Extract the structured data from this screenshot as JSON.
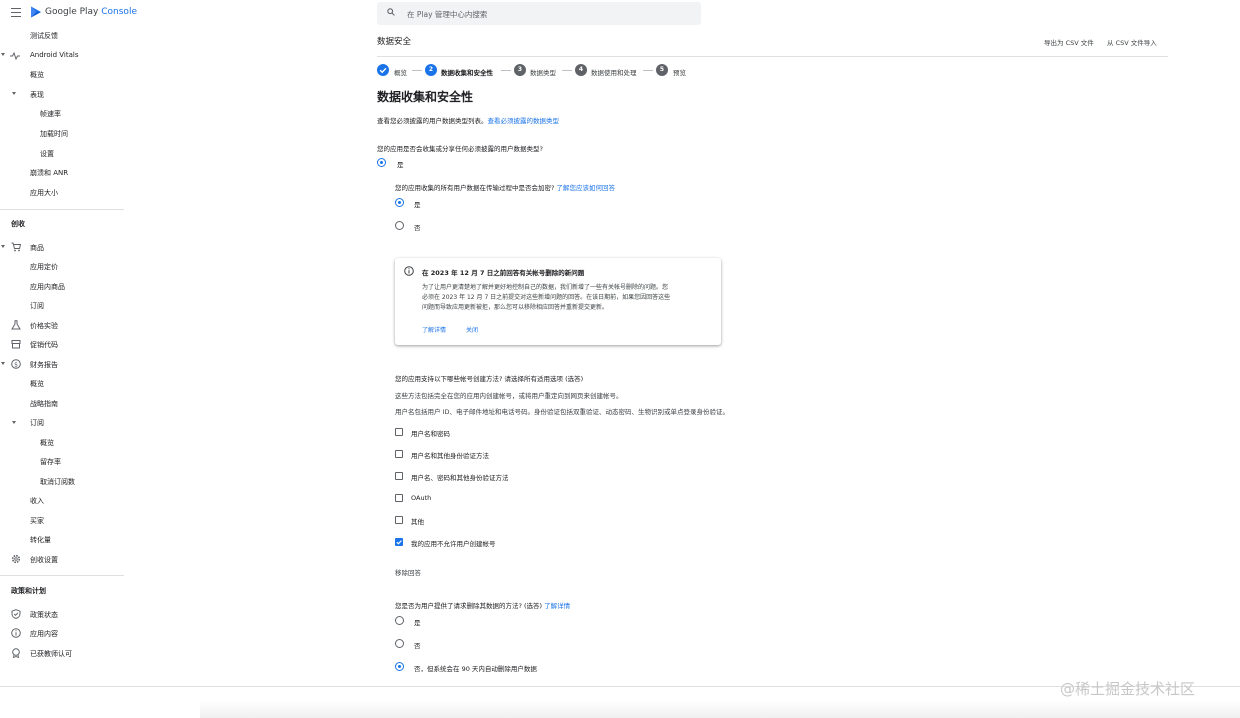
{
  "topbar": {
    "brand_google_play": "Google Play",
    "brand_console": "Console",
    "search_placeholder": "在 Play 管理中心内搜索"
  },
  "sidebar": {
    "test_feedback": "测试反馈",
    "android_vitals": "Android Vitals",
    "vitals_overview": "概览",
    "performance": "表现",
    "frame_rate": "帧速率",
    "load_time": "加载时间",
    "settings": "设置",
    "crashes_anr": "崩溃和 ANR",
    "app_size": "应用大小",
    "monetize_header": "创收",
    "products": "商品",
    "app_pricing": "应用定价",
    "in_app_products": "应用内商品",
    "subscriptions": "订阅",
    "price_experiments": "价格实验",
    "promo_codes": "促销代码",
    "financial_reports": "财务报告",
    "fin_overview": "概览",
    "strategy_guide": "战略指南",
    "fin_subscriptions": "订阅",
    "sub_overview": "概览",
    "retention": "留存率",
    "cancellations": "取消订阅数",
    "revenue": "收入",
    "buyers": "买家",
    "conversions": "转化量",
    "monetization_setup": "创收设置",
    "policy_header": "政策和计划",
    "policy_status": "政策状态",
    "app_content": "应用内容",
    "teacher_approved": "已获教师认可"
  },
  "header": {
    "title": "数据安全",
    "export_csv": "导出为 CSV 文件",
    "import_csv": "从 CSV 文件导入"
  },
  "stepper": [
    {
      "num": "✓",
      "label": "概览",
      "state": "done"
    },
    {
      "num": "2",
      "label": "数据收集和安全性",
      "state": "active"
    },
    {
      "num": "3",
      "label": "数据类型",
      "state": "pending"
    },
    {
      "num": "4",
      "label": "数据使用和处理",
      "state": "pending"
    },
    {
      "num": "5",
      "label": "预览",
      "state": "pending"
    }
  ],
  "main": {
    "title": "数据收集和安全性",
    "intro": "查看您必须披露的用户数据类型列表。",
    "intro_link": "查看必须披露的数据类型",
    "q1": "您的应用是否会收集或分享任何必须披露的用户数据类型?",
    "q1_yes": "是",
    "q2": "您的应用收集的所有用户数据在传输过程中是否会加密?",
    "q2_link": "了解您应该如何回答",
    "q2_yes": "是",
    "q2_no": "否",
    "q3": "您的应用支持以下哪些帐号创建方法? 请选择所有适用选项 (选答)",
    "q3_desc1": "这些方法包括完全在您的应用内创建帐号，或将用户重定向到网页来创建帐号。",
    "q3_desc2": "用户名包括用户 ID、电子邮件地址和电话号码。身份验证包括双重验证、动态密码、生物识别或单点登录身份验证。",
    "q3_options": [
      {
        "label": "用户名和密码",
        "checked": false
      },
      {
        "label": "用户名和其他身份验证方法",
        "checked": false
      },
      {
        "label": "用户名、密码和其他身份验证方法",
        "checked": false
      },
      {
        "label": "OAuth",
        "checked": false
      },
      {
        "label": "其他",
        "checked": false
      },
      {
        "label": "我的应用不允许用户创建帐号",
        "checked": true
      }
    ],
    "clear_answer": "移除回答",
    "q4": "您是否为用户提供了请求删除其数据的方法? (选答)",
    "q4_link": "了解详情",
    "q4_yes": "是",
    "q4_no": "否",
    "q4_no_auto": "否，但系统会在 90 天内自动删除用户数据"
  },
  "notice": {
    "title": "在 2023 年 12 月 7 日之前回答有关帐号删除的新问题",
    "body": "为了让用户更清楚地了解并更好地控制自己的数据，我们新增了一些有关帐号删除的问题。您必须在 2023 年 12 月 7 日之前提交对这些新增问题的回答。在该日期前，如果您因回答这些问题而导致应用更新被拒，那么您可以移除相应回答并重新提交更新。",
    "learn_more": "了解详情",
    "close": "关闭"
  },
  "watermark": "@稀土掘金技术社区",
  "colors": {
    "accent": "#1a73e8",
    "text": "#202124",
    "muted": "#5f6368"
  }
}
